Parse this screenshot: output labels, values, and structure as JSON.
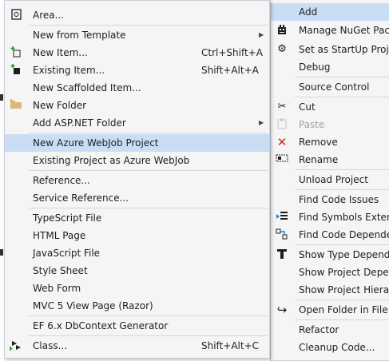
{
  "submenu": {
    "items": [
      {
        "label": "Area...",
        "icon": "area-icon"
      },
      {
        "label": "New from Template",
        "has_submenu": true
      },
      {
        "label": "New Item...",
        "shortcut": "Ctrl+Shift+A",
        "icon": "new-item-icon"
      },
      {
        "label": "Existing Item...",
        "shortcut": "Shift+Alt+A",
        "icon": "existing-item-icon"
      },
      {
        "label": "New Scaffolded Item..."
      },
      {
        "label": "New Folder",
        "icon": "folder-icon"
      },
      {
        "label": "Add ASP.NET Folder",
        "has_submenu": true
      },
      {
        "label": "New Azure WebJob Project",
        "highlighted": true
      },
      {
        "label": "Existing Project as Azure WebJob"
      },
      {
        "label": "Reference..."
      },
      {
        "label": "Service Reference..."
      },
      {
        "label": "TypeScript File"
      },
      {
        "label": "HTML Page"
      },
      {
        "label": "JavaScript File"
      },
      {
        "label": "Style Sheet"
      },
      {
        "label": "Web Form"
      },
      {
        "label": "MVC 5 View Page (Razor)"
      },
      {
        "label": "EF 6.x DbContext Generator"
      },
      {
        "label": "Class...",
        "shortcut": "Shift+Alt+C",
        "icon": "class-icon"
      }
    ]
  },
  "parentmenu": {
    "items": [
      {
        "label": "Add",
        "highlighted": true
      },
      {
        "label": "Manage NuGet Packa",
        "icon": "nuget-icon"
      },
      {
        "label": "Set as StartUp Project",
        "icon": "gear-icon"
      },
      {
        "label": "Debug"
      },
      {
        "label": "Source Control"
      },
      {
        "label": "Cut",
        "icon": "scissors-icon"
      },
      {
        "label": "Paste",
        "icon": "clipboard-icon",
        "disabled": true
      },
      {
        "label": "Remove",
        "icon": "red-x-icon"
      },
      {
        "label": "Rename",
        "icon": "rename-icon"
      },
      {
        "label": "Unload Project"
      },
      {
        "label": "Find Code Issues"
      },
      {
        "label": "Find Symbols Externa",
        "icon": "find-symbols-icon"
      },
      {
        "label": "Find Code Dependent",
        "icon": "find-dependencies-icon"
      },
      {
        "label": "Show Type Depender",
        "icon": "type-dependency-icon"
      },
      {
        "label": "Show Project Depend"
      },
      {
        "label": "Show Project Hierarch"
      },
      {
        "label": "Open Folder in File Ex",
        "icon": "open-folder-arrow-icon"
      },
      {
        "label": "Refactor"
      },
      {
        "label": "Cleanup Code..."
      }
    ]
  },
  "colors": {
    "highlight": "#c9def5",
    "menu_bg": "#f5f5f5",
    "remove_icon": "#c42b1c"
  }
}
